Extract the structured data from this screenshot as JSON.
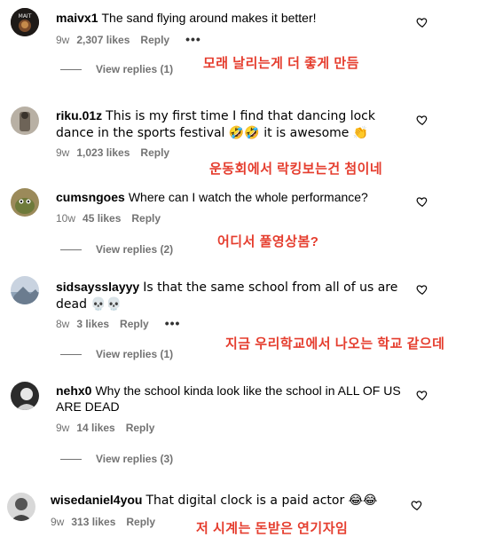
{
  "colors": {
    "annotation": "#e53d2e",
    "meta": "#737373"
  },
  "comments": [
    {
      "username": "maivx1",
      "text": "The sand flying around makes it better!",
      "age": "9w",
      "likes": "2,307 likes",
      "reply": "Reply",
      "more": "•••",
      "view_replies": "View replies (1)",
      "annotation": "모래 날리는게 더 좋게 만듬"
    },
    {
      "username": "riku.01z",
      "text": "This is my first time I find that dancing lock dance in the sports festival 🤣🤣 it is awesome 👏",
      "age": "9w",
      "likes": "1,023 likes",
      "reply": "Reply",
      "annotation": "운동회에서 락킹보는건 첨이네"
    },
    {
      "username": "cumsngoes",
      "text": "Where can I watch the whole performance?",
      "age": "10w",
      "likes": "45 likes",
      "reply": "Reply",
      "view_replies": "View replies (2)",
      "annotation": "어디서 풀영상봄?"
    },
    {
      "username": "sidsaysslayyy",
      "text": "Is that the same school from all of us are dead 💀💀",
      "age": "8w",
      "likes": "3 likes",
      "reply": "Reply",
      "more": "•••",
      "view_replies": "View replies (1)",
      "annotation": "지금 우리학교에서 나오는 학교 같으데"
    },
    {
      "username": "nehx0",
      "text": "Why the school kinda look like the school in ALL OF US ARE DEAD",
      "age": "9w",
      "likes": "14 likes",
      "reply": "Reply",
      "view_replies": "View replies (3)"
    },
    {
      "username": "wisedaniel4you",
      "text": "That digital clock is a paid actor 😂😂",
      "age": "9w",
      "likes": "313 likes",
      "reply": "Reply",
      "annotation": "저 시계는 돈받은 연기자임"
    }
  ],
  "icons": {
    "like": "heart-outline-icon"
  }
}
